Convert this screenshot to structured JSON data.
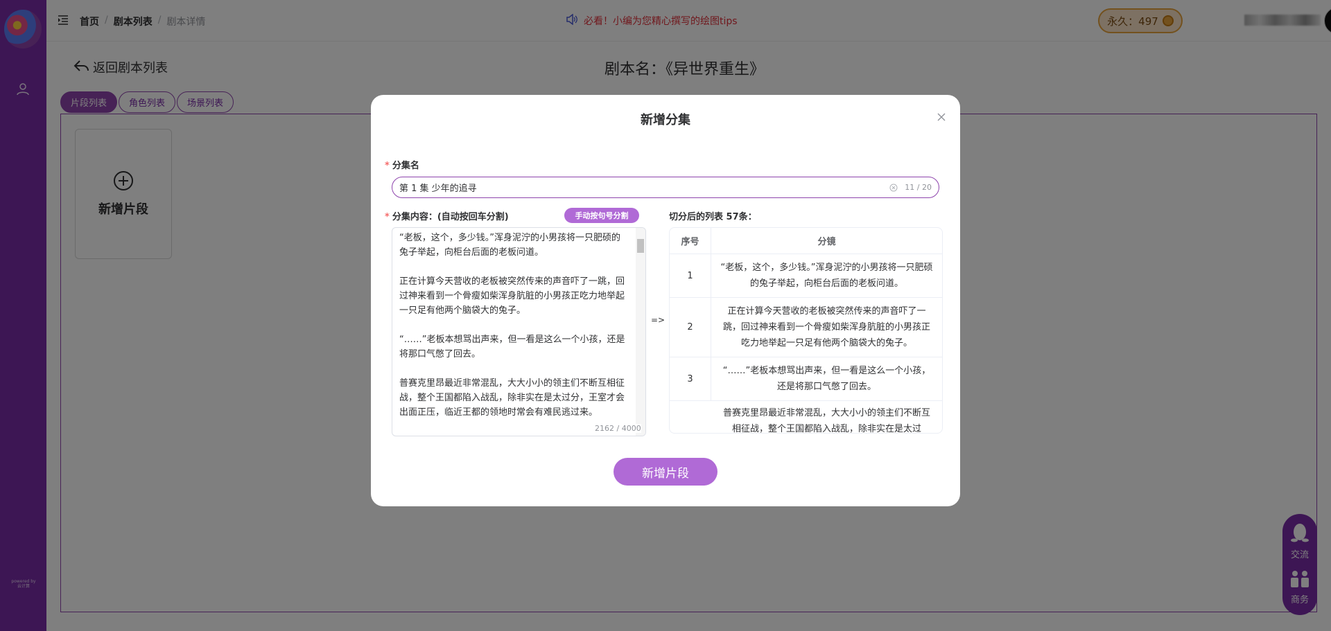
{
  "sidebar": {
    "powered_label": "powered by\n云计算"
  },
  "topbar": {
    "breadcrumb": [
      "首页",
      "剧本列表",
      "剧本详情"
    ],
    "breadcrumb_sep": "/",
    "notice": "必看！小编为您精心撰写的绘图tips",
    "coin": {
      "label": "永久：497"
    }
  },
  "page": {
    "back_label": "返回剧本列表",
    "script_title": "剧本名：《异世界重生》",
    "tabs": [
      "片段列表",
      "角色列表",
      "场景列表"
    ],
    "active_tab": 0,
    "add_card_label": "新增片段"
  },
  "float_widget": {
    "item1": "交流",
    "item2": "商务"
  },
  "dialog": {
    "title": "新增分集",
    "name_label": "分集名",
    "name_value": "第 1 集 少年的追寻",
    "name_counter": "11 / 20",
    "content_label": "分集内容：(自动按回车分割)",
    "split_button": "手动按句号分割",
    "content_paragraphs": [
      "“老板，这个，多少钱。”浑身泥泞的小男孩将一只肥硕的兔子举起，向柜台后面的老板问道。",
      "正在计算今天营收的老板被突然传来的声音吓了一跳，回过神来看到一个骨瘦如柴浑身肮脏的小男孩正吃力地举起一只足有他两个脑袋大的兔子。",
      "“……”老板本想骂出声来，但一看是这么一个小孩，还是将那口气憋了回去。",
      "普赛克里昂最近非常混乱，大大小小的领主们不断互相征战，整个王国都陷入战乱，除非实在是太过分，王室才会出面正压，临近王都的领地时常会有难民逃过来。"
    ],
    "content_counter": "2162 / 4000",
    "arrow": "=>",
    "result_label": "切分后的列表 57条：",
    "table_headers": [
      "序号",
      "分镜"
    ],
    "table_rows": [
      {
        "no": "1",
        "text": "“老板，这个，多少钱。”浑身泥泞的小男孩将一只肥硕的兔子举起，向柜台后面的老板问道。"
      },
      {
        "no": "2",
        "text": "正在计算今天营收的老板被突然传来的声音吓了一跳，回过神来看到一个骨瘦如柴浑身肮脏的小男孩正吃力地举起一只足有他两个脑袋大的兔子。"
      },
      {
        "no": "3",
        "text": "“……”老板本想骂出声来，但一看是这么一个小孩，还是将那口气憋了回去。"
      },
      {
        "no": "",
        "text": "普赛克里昂最近非常混乱，大大小小的领主们不断互相征战，整个王国都陷入战乱，除非实在是太过"
      }
    ],
    "submit_button": "新增片段"
  }
}
